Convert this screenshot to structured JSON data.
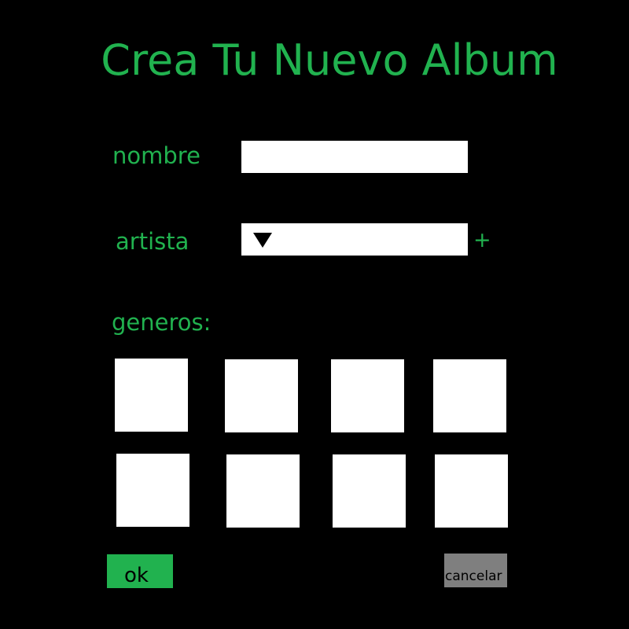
{
  "form": {
    "title": "Crea Tu Nuevo Album",
    "fields": {
      "nombre_label": "nombre",
      "nombre_value": "",
      "artista_label": "artista",
      "artista_selected": "",
      "add_artista_label": "+"
    },
    "generos_label": "generos:",
    "generos": [
      {
        "label": ""
      },
      {
        "label": ""
      },
      {
        "label": ""
      },
      {
        "label": ""
      },
      {
        "label": ""
      },
      {
        "label": ""
      },
      {
        "label": ""
      },
      {
        "label": ""
      }
    ],
    "buttons": {
      "ok_label": "ok",
      "cancel_label": "cancelar"
    }
  },
  "colors": {
    "background": "#000000",
    "accent": "#21b24f",
    "input_background": "#ffffff",
    "cancel_background": "#7f7f7f"
  },
  "icons": {
    "dropdown": "triangle-down-icon"
  }
}
